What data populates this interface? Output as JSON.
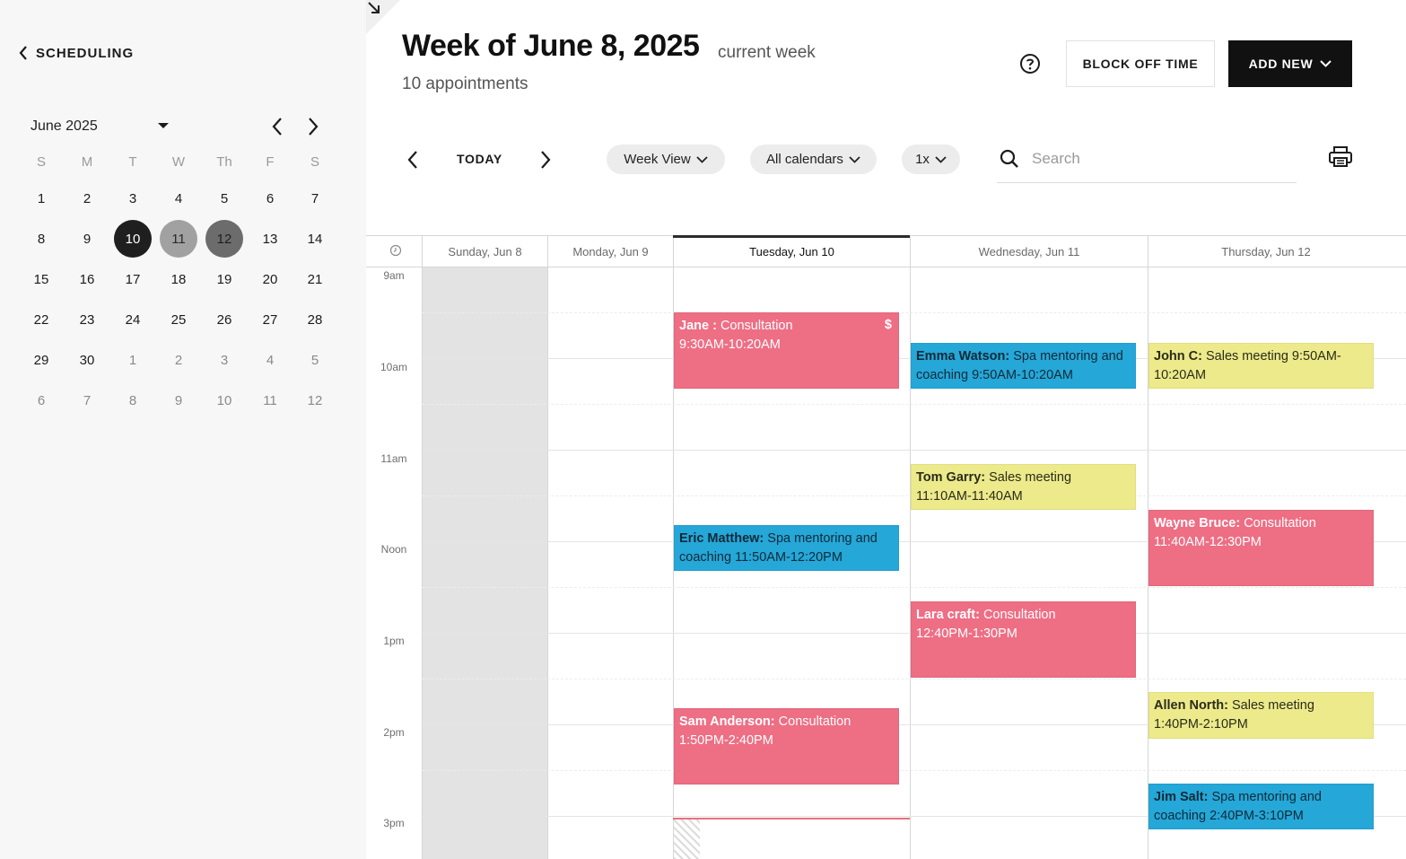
{
  "sidebar": {
    "back_label": "SCHEDULING",
    "mini_calendar": {
      "month_label": "June 2025",
      "weekdays": [
        "S",
        "M",
        "T",
        "W",
        "Th",
        "F",
        "S"
      ],
      "weeks": [
        [
          "1",
          "2",
          "3",
          "4",
          "5",
          "6",
          "7"
        ],
        [
          "8",
          "9",
          "10",
          "11",
          "12",
          "13",
          "14"
        ],
        [
          "15",
          "16",
          "17",
          "18",
          "19",
          "20",
          "21"
        ],
        [
          "22",
          "23",
          "24",
          "25",
          "26",
          "27",
          "28"
        ],
        [
          "29",
          "30",
          "1",
          "2",
          "3",
          "4",
          "5"
        ],
        [
          "6",
          "7",
          "8",
          "9",
          "10",
          "11",
          "12"
        ]
      ]
    }
  },
  "header": {
    "title": "Week of June 8, 2025",
    "subtitle": "current week",
    "appointment_count": "10 appointments",
    "block_off_label": "BLOCK OFF TIME",
    "add_new_label": "ADD NEW"
  },
  "toolbar": {
    "today_label": "TODAY",
    "view_label": "Week View",
    "calendars_label": "All calendars",
    "zoom_label": "1x",
    "search_placeholder": "Search"
  },
  "calendar": {
    "columns": [
      "Sunday, Jun 8",
      "Monday, Jun 9",
      "Tuesday, Jun 10",
      "Wednesday, Jun 11",
      "Thursday, Jun 12"
    ],
    "active_column": "Tuesday, Jun 10",
    "time_labels": [
      "9am",
      "10am",
      "11am",
      "Noon",
      "1pm",
      "2pm",
      "3pm"
    ]
  },
  "events": [
    {
      "day": "Tuesday, Jun 10",
      "name": "Jane :",
      "service": "Consultation",
      "time": "9:30AM-10:20AM",
      "color": "pink",
      "badge": "$"
    },
    {
      "day": "Tuesday, Jun 10",
      "name": "Eric Matthew:",
      "service": "Spa mentoring and coaching",
      "time": "11:50AM-12:20PM",
      "color": "blue"
    },
    {
      "day": "Tuesday, Jun 10",
      "name": "Sam Anderson:",
      "service": "Consultation",
      "time": "1:50PM-2:40PM",
      "color": "pink"
    },
    {
      "day": "Wednesday, Jun 11",
      "name": "Emma Watson:",
      "service": "Spa mentoring and coaching",
      "time": "9:50AM-10:20AM",
      "color": "blue"
    },
    {
      "day": "Wednesday, Jun 11",
      "name": "Tom Garry:",
      "service": "Sales meeting",
      "time": "11:10AM-11:40AM",
      "color": "yellow"
    },
    {
      "day": "Wednesday, Jun 11",
      "name": "Lara craft:",
      "service": "Consultation",
      "time": "12:40PM-1:30PM",
      "color": "pink"
    },
    {
      "day": "Thursday, Jun 12",
      "name": "John C:",
      "service": "Sales meeting",
      "time": "9:50AM-10:20AM",
      "color": "yellow"
    },
    {
      "day": "Thursday, Jun 12",
      "name": "Wayne Bruce:",
      "service": "Consultation",
      "time": "11:40AM-12:30PM",
      "color": "pink"
    },
    {
      "day": "Thursday, Jun 12",
      "name": "Allen North:",
      "service": "Sales meeting",
      "time": "1:40PM-2:10PM",
      "color": "yellow"
    },
    {
      "day": "Thursday, Jun 12",
      "name": "Jim Salt:",
      "service": "Spa mentoring and coaching",
      "time": "2:40PM-3:10PM",
      "color": "blue"
    }
  ],
  "colors": {
    "pink": "#ee6e84",
    "blue": "#25a7d8",
    "yellow": "#ecea8a",
    "primary_button": "#111111",
    "selected_day": "#1f1f1f"
  },
  "icons": [
    "chevron-left-icon",
    "chevron-right-icon",
    "caret-down-icon",
    "help-icon",
    "chevron-down-icon",
    "search-icon",
    "print-icon",
    "clock-icon",
    "resize-arrow-icon"
  ]
}
